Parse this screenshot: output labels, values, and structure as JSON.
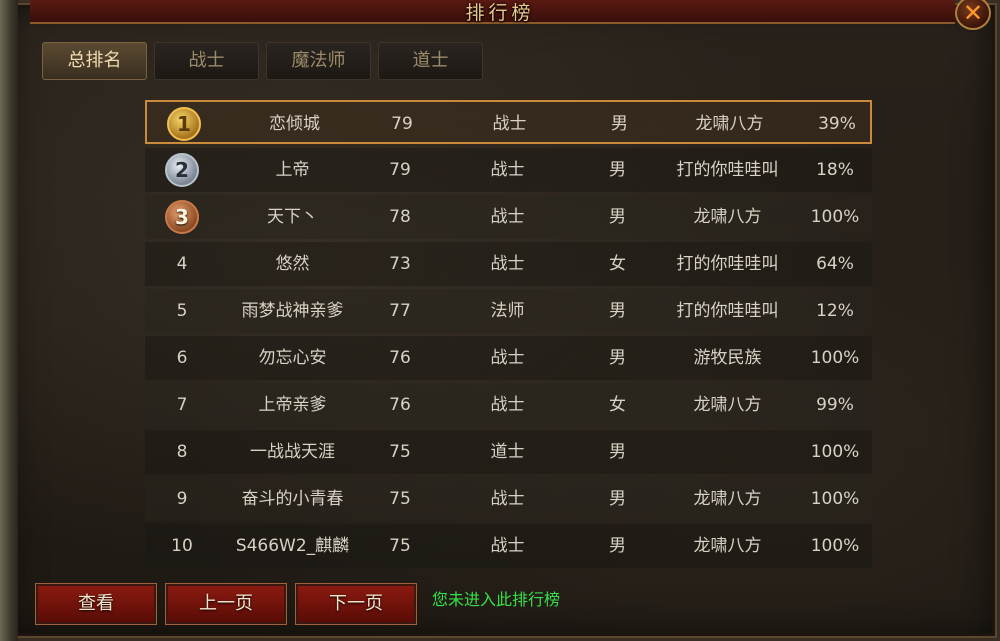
{
  "window": {
    "title": "排行榜",
    "close_icon": "✕"
  },
  "tabs": [
    {
      "label": "总排名",
      "active": true
    },
    {
      "label": "战士",
      "active": false
    },
    {
      "label": "魔法师",
      "active": false
    },
    {
      "label": "道士",
      "active": false
    }
  ],
  "ranking": [
    {
      "rank": "1",
      "name": "恋倾城",
      "level": "79",
      "job": "战士",
      "sex": "男",
      "guild": "龙啸八方",
      "percent": "39%",
      "medal": "gold"
    },
    {
      "rank": "2",
      "name": "上帝",
      "level": "79",
      "job": "战士",
      "sex": "男",
      "guild": "打的你哇哇叫",
      "percent": "18%",
      "medal": "silver"
    },
    {
      "rank": "3",
      "name": "天下丶",
      "level": "78",
      "job": "战士",
      "sex": "男",
      "guild": "龙啸八方",
      "percent": "100%",
      "medal": "bronze"
    },
    {
      "rank": "4",
      "name": "悠然",
      "level": "73",
      "job": "战士",
      "sex": "女",
      "guild": "打的你哇哇叫",
      "percent": "64%"
    },
    {
      "rank": "5",
      "name": "雨梦战神亲爹",
      "level": "77",
      "job": "法师",
      "sex": "男",
      "guild": "打的你哇哇叫",
      "percent": "12%"
    },
    {
      "rank": "6",
      "name": "勿忘心安",
      "level": "76",
      "job": "战士",
      "sex": "男",
      "guild": "游牧民族",
      "percent": "100%"
    },
    {
      "rank": "7",
      "name": "上帝亲爹",
      "level": "76",
      "job": "战士",
      "sex": "女",
      "guild": "龙啸八方",
      "percent": "99%"
    },
    {
      "rank": "8",
      "name": "一战战天涯",
      "level": "75",
      "job": "道士",
      "sex": "男",
      "guild": "",
      "percent": "100%"
    },
    {
      "rank": "9",
      "name": "奋斗的小青春",
      "level": "75",
      "job": "战士",
      "sex": "男",
      "guild": "龙啸八方",
      "percent": "100%"
    },
    {
      "rank": "10",
      "name": "S466W2_麒麟",
      "level": "75",
      "job": "战士",
      "sex": "男",
      "guild": "龙啸八方",
      "percent": "100%"
    }
  ],
  "buttons": {
    "view": "查看",
    "prev": "上一页",
    "next": "下一页"
  },
  "notice": {
    "text": "您未进入此排行榜",
    "color": "#36e048"
  },
  "colors": {
    "accent": "#c98a3a",
    "title": "#e9c98a",
    "button": "#8a1a10"
  }
}
